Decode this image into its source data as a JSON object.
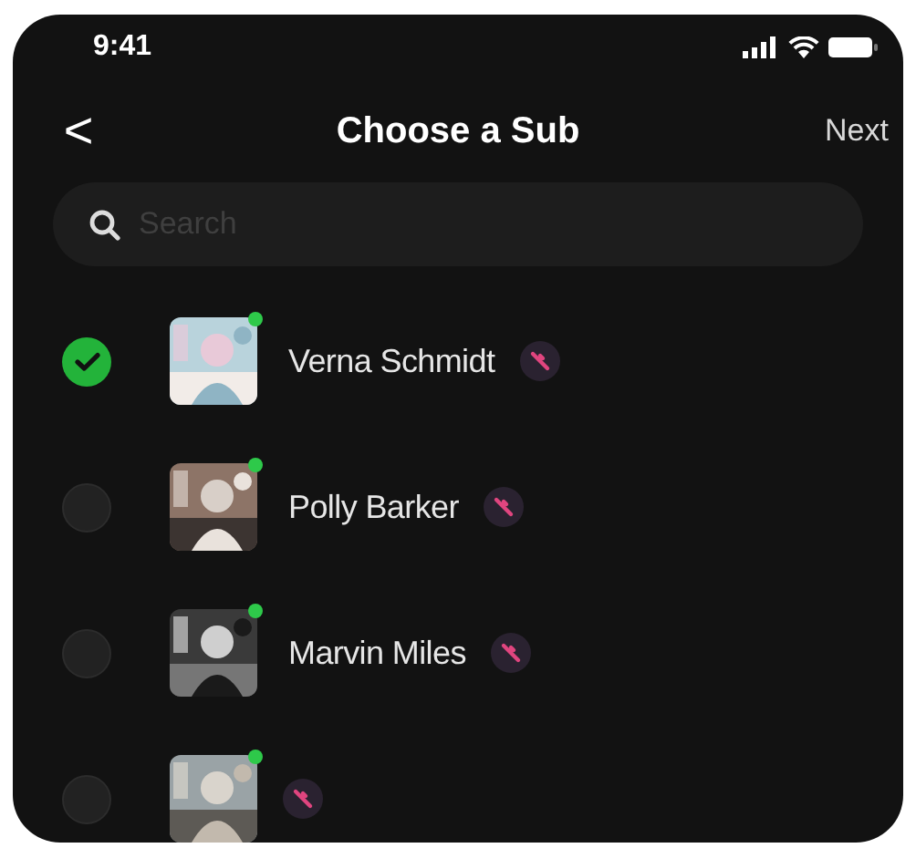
{
  "status_bar": {
    "time": "9:41"
  },
  "nav": {
    "back": "<",
    "title": "Choose a Sub",
    "action": "Next"
  },
  "search": {
    "placeholder": "Search"
  },
  "contacts": [
    {
      "name": "Verna Schmidt",
      "selected": true,
      "online": true
    },
    {
      "name": "Polly Barker",
      "selected": false,
      "online": true
    },
    {
      "name": "Marvin Miles",
      "selected": false,
      "online": true
    },
    {
      "selected": false,
      "online": true
    }
  ]
}
